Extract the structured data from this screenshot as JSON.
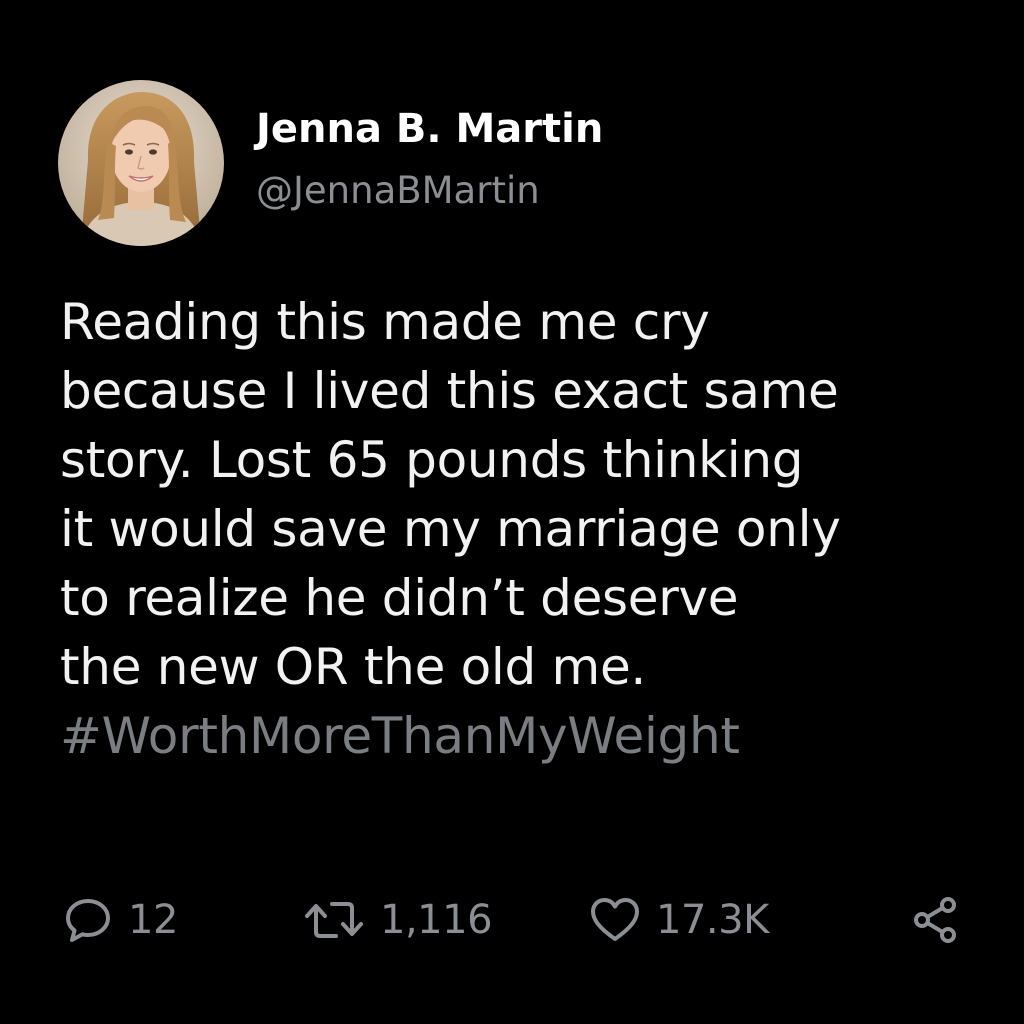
{
  "user": {
    "display_name": "Jenna B. Martin",
    "handle": "@JennaBMartin"
  },
  "tweet": {
    "lines": [
      "Reading this made me cry",
      "because I lived this exact same",
      "story. Lost 65 pounds thinking",
      "it would save my marriage only",
      "to realize he didn’t deserve",
      "the new OR the old me."
    ],
    "hashtag": "#WorthMoreThanMyWeight"
  },
  "actions": {
    "reply": {
      "icon": "reply-icon",
      "count": "12"
    },
    "retweet": {
      "icon": "retweet-icon",
      "count": "1,116"
    },
    "like": {
      "icon": "heart-icon",
      "count": "17.3K"
    },
    "share": {
      "icon": "share-icon"
    }
  },
  "colors": {
    "background": "#000000",
    "text": "#f2f2f2",
    "muted": "#8b8f93",
    "hashtag": "#7a7e82"
  }
}
